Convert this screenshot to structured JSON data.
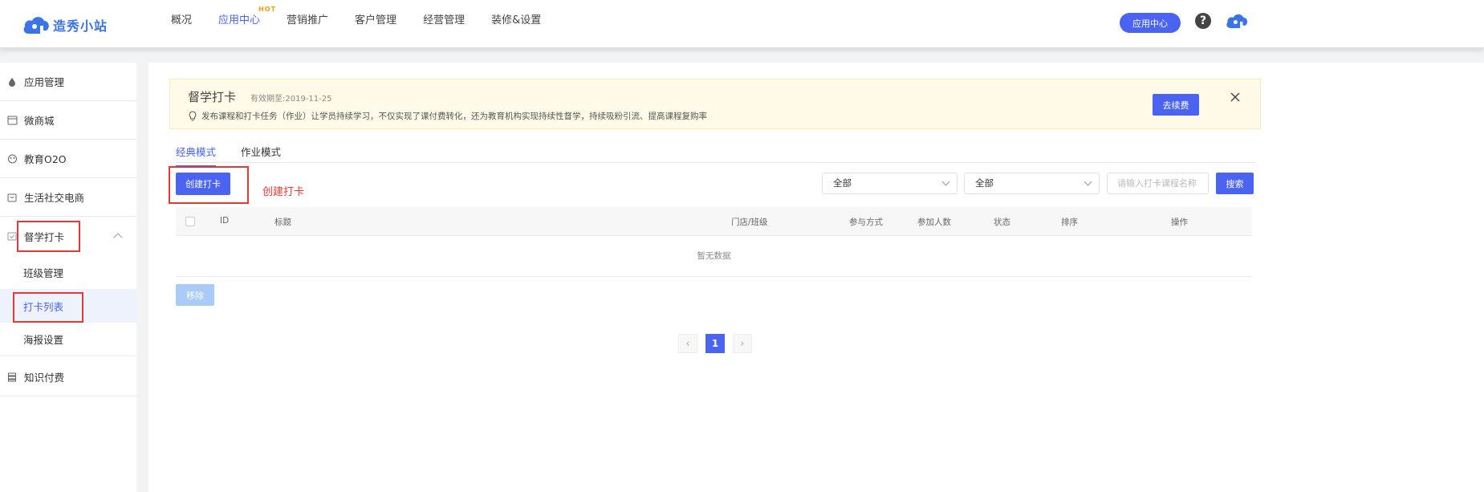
{
  "header": {
    "logo_text": "造秀小站",
    "nav": [
      {
        "label": "概况"
      },
      {
        "label": "应用中心",
        "badge": "HOT"
      },
      {
        "label": "营销推广"
      },
      {
        "label": "客户管理"
      },
      {
        "label": "经营管理"
      },
      {
        "label": "装修&设置"
      }
    ],
    "app_center_button": "应用中心",
    "help_icon": "?"
  },
  "sidebar": {
    "items": [
      {
        "label": "应用管理",
        "icon": "drop-icon"
      },
      {
        "label": "微商城",
        "icon": "shop-icon"
      },
      {
        "label": "教育O2O",
        "icon": "education-icon"
      },
      {
        "label": "生活社交电商",
        "icon": "bag-icon"
      },
      {
        "label": "督学打卡",
        "icon": "checkin-icon"
      },
      {
        "label": "知识付费",
        "icon": "stack-icon"
      }
    ],
    "sub_items": [
      {
        "label": "班级管理"
      },
      {
        "label": "打卡列表"
      },
      {
        "label": "海报设置"
      }
    ]
  },
  "notice": {
    "title": "督学打卡",
    "expire": "有效期至:2019-11-25",
    "description": "发布课程和打卡任务（作业）让学员持续学习，不仅实现了课付费转化，还为教育机构实现持续性督学，持续吸粉引流、提高课程复购率",
    "renew_button": "去续费"
  },
  "tabs": [
    {
      "label": "经典模式"
    },
    {
      "label": "作业模式"
    }
  ],
  "toolbar": {
    "create_button": "创建打卡",
    "create_note": "创建打卡",
    "filter1": "全部",
    "filter2": "全部",
    "search_placeholder": "请输入打卡课程名称",
    "search_button": "搜索"
  },
  "table": {
    "columns": [
      "ID",
      "标题",
      "门店/班级",
      "参与方式",
      "参加人数",
      "状态",
      "排序",
      "操作"
    ],
    "empty_text": "暂无数据",
    "remove_button": "移除"
  },
  "pagination": {
    "current_page": "1",
    "prev": "‹",
    "next": "›"
  },
  "colors": {
    "primary": "#4a63f0",
    "highlight_box": "#e53935",
    "notice_bg": "#fffbe8"
  }
}
